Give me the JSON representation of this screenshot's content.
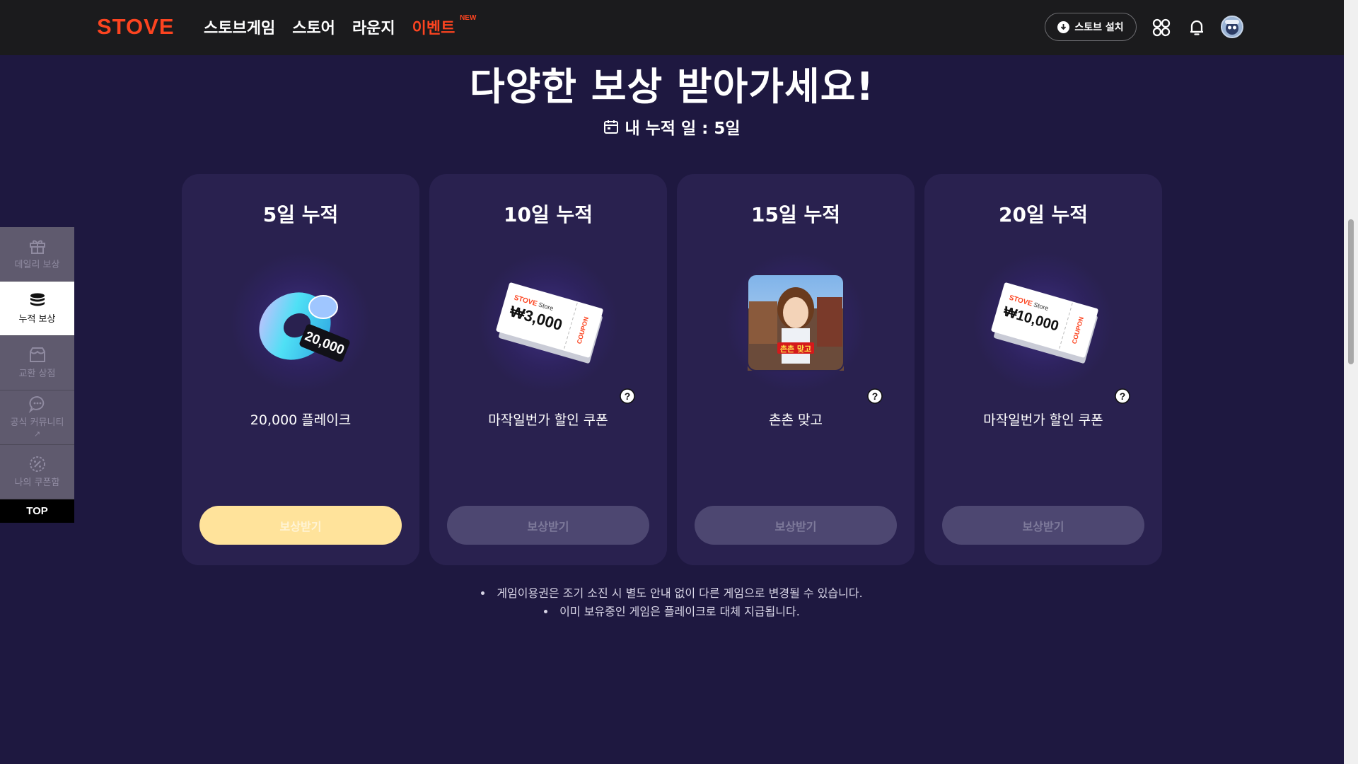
{
  "header": {
    "logo": "STOVE",
    "nav": [
      {
        "label": "스토브게임"
      },
      {
        "label": "스토어"
      },
      {
        "label": "라운지"
      },
      {
        "label": "이벤트",
        "badge": "NEW"
      }
    ],
    "install_label": "스토브 설치",
    "icons": [
      "grid-icon",
      "bell-icon",
      "avatar"
    ]
  },
  "hero": {
    "title": "다양한 보상 받아가세요!",
    "accum_label": "내 누적 일 : 5일"
  },
  "cards": [
    {
      "title": "5일 누적",
      "label": "20,000 플레이크",
      "button": "보상받기",
      "state": "active",
      "art": "flake-ring",
      "art_text": "20,000",
      "help": false
    },
    {
      "title": "10일 누적",
      "label": "마작일번가 할인 쿠폰",
      "button": "보상받기",
      "state": "disabled",
      "art": "coupon",
      "art_text": "₩3,000",
      "help": true
    },
    {
      "title": "15일 누적",
      "label": "촌촌 맞고",
      "button": "보상받기",
      "state": "disabled",
      "art": "game",
      "art_text": "촌촌 맞고",
      "help": true
    },
    {
      "title": "20일 누적",
      "label": "마작일번가 할인 쿠폰",
      "button": "보상받기",
      "state": "disabled",
      "art": "coupon",
      "art_text": "₩10,000",
      "help": true
    }
  ],
  "coupon_brand": "STOVE",
  "coupon_store": "Store",
  "coupon_word": "COUPON",
  "notes": [
    "게임이용권은 조기 소진 시 별도 안내 없이 다른 게임으로 변경될 수 있습니다.",
    "이미 보유중인 게임은 플레이크로 대체 지급됩니다."
  ],
  "dock": {
    "items": [
      {
        "label": "데일리 보상",
        "icon": "gift-icon"
      },
      {
        "label": "누적 보상",
        "icon": "coin-stack-icon",
        "active": true
      },
      {
        "label": "교환 상점",
        "icon": "shop-icon"
      },
      {
        "label": "공식 커뮤니티",
        "icon": "chat-icon",
        "external": true
      },
      {
        "label": "나의 쿠폰함",
        "icon": "coupon-icon",
        "external": true
      }
    ],
    "top_label": "TOP"
  },
  "colors": {
    "page_bg": "#1e1840",
    "card_bg": "#29214f",
    "brand": "#fc4420",
    "active_button": "#ffe39b",
    "disabled_button": "#4d4771"
  }
}
